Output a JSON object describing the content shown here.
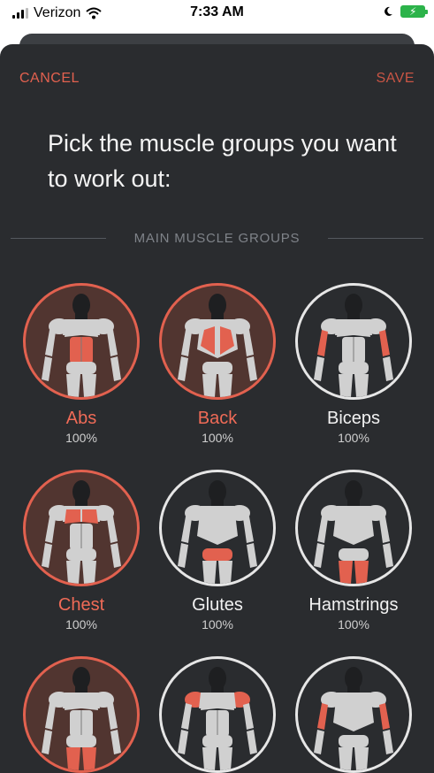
{
  "status_bar": {
    "carrier": "Verizon",
    "time": "7:33 AM",
    "icons": [
      "signal-icon",
      "wifi-icon",
      "moon-icon",
      "battery-charging-icon"
    ]
  },
  "nav": {
    "cancel_label": "CANCEL",
    "save_label": "SAVE"
  },
  "title": "Pick the muscle groups you want to work out:",
  "section_header": "MAIN MUSCLE GROUPS",
  "colors": {
    "accent": "#e2614f",
    "background": "#2a2c2f",
    "selected_circle": "#513530",
    "body": "#d0d0d0",
    "head": "#1e1f21"
  },
  "muscle_groups": [
    {
      "name": "Abs",
      "percent": "100%",
      "selected": true,
      "highlight": "abs",
      "view": "front"
    },
    {
      "name": "Back",
      "percent": "100%",
      "selected": true,
      "highlight": "back",
      "view": "back"
    },
    {
      "name": "Biceps",
      "percent": "100%",
      "selected": false,
      "highlight": "biceps",
      "view": "front"
    },
    {
      "name": "Chest",
      "percent": "100%",
      "selected": true,
      "highlight": "chest",
      "view": "front"
    },
    {
      "name": "Glutes",
      "percent": "100%",
      "selected": false,
      "highlight": "glutes",
      "view": "back"
    },
    {
      "name": "Hamstrings",
      "percent": "100%",
      "selected": false,
      "highlight": "hamstrings",
      "view": "back"
    },
    {
      "name": "",
      "percent": "",
      "selected": true,
      "highlight": "quads",
      "view": "front"
    },
    {
      "name": "",
      "percent": "",
      "selected": false,
      "highlight": "shoulders",
      "view": "front"
    },
    {
      "name": "",
      "percent": "",
      "selected": false,
      "highlight": "triceps",
      "view": "back"
    }
  ]
}
